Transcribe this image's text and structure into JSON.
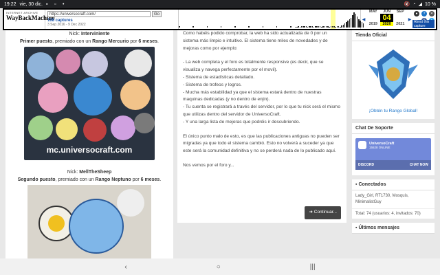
{
  "status_bar": {
    "time": "19:22",
    "date": "vie, 30 dic.",
    "battery": "10 %"
  },
  "wayback": {
    "logo_top": "INTERNET ARCHIVE",
    "logo_wayback": "WayBack",
    "logo_machine": "Machine",
    "url": "https://universocraft.com/",
    "go_label": "Go",
    "captures": "108 captures",
    "range": "3 Sep 2016 - 9 Dec 2022",
    "years": [
      {
        "month": "MAY",
        "day": "",
        "year": "2019"
      },
      {
        "month": "JUN",
        "day": "04",
        "year": "2020"
      },
      {
        "month": "SEP",
        "day": "",
        "year": "2021"
      }
    ],
    "about": "About this capture"
  },
  "left": {
    "nick1_prefix": "Nick: ",
    "nick1_name": "Interviniente",
    "place1_a": "Primer puesto",
    "place1_b": ", premiado con un ",
    "place1_c": "Rango Mercurio",
    "place1_d": " por ",
    "place1_e": "6 meses",
    "place1_f": ".",
    "photo1_caption": "mc.universocraft.com",
    "nick2_prefix": "Nick: ",
    "nick2_name": "MellTheSheep",
    "place2_a": "Segundo puesto",
    "place2_b": ", premiado con un ",
    "place2_c": "Rango Neptuno",
    "place2_d": " por ",
    "place2_e": "6 meses",
    "place2_f": "."
  },
  "main": {
    "p1": "Como habéis podido comprobar, la web ha sido actualizada de 0 por un sistema más limpio e intuitivo. El sistema tiene miles de novedades y de mejoras como por ejemplo:",
    "l1": "- La web completa y el foro es totalmente responsive (es decir, que se visualiza y navega perfectamente por el movil).",
    "l2": "- Sistema de estadísticas detallado.",
    "l3": "- Sistema de trofeos y logros.",
    "l4": "- Mucha más estabilidad ya que el sistema estará dentro de nuestras maquinas dedicadas (y no dentro de enjin).",
    "l5": "- Tu cuenta se registrará a través del servidor, por lo que tu nick será el mismo que utilizas dentro del servidor de UniversoCraft.",
    "l6": "- Y una larga lista de mejoras que podréis ir descubriendo.",
    "p2": "El único punto malo de esto, es que las publicaciones antiguas no pueden ser migradas ya que todo el sistema cambió. Esto no volverá a suceder ya que este será la comunidad definitiva y no se perderá nada de lo publicado aquí.",
    "p3": "Nos vemos por el foro y...",
    "continue": "Continuar..."
  },
  "right": {
    "shop_title": "Tienda Oficial",
    "shop_link": "¡Obtén tu Rango Global!",
    "discord_title": "Chat De Soporte",
    "discord_name": "UniversoCraft",
    "discord_online": "15528 ONLINE",
    "discord_logo": "DISCORD",
    "discord_chat": "CHAT NOW",
    "connected_title": "Conectados",
    "connected_list": "Lady_Girl, RT1730, Mosquis, MinimalistGuy",
    "connected_total": "Total: 74 (usuarios: 4, invitados: 70)",
    "latest_title": "Últimos mensajes"
  },
  "navbar": {
    "back": "‹",
    "home": "○",
    "recent": "|||"
  }
}
